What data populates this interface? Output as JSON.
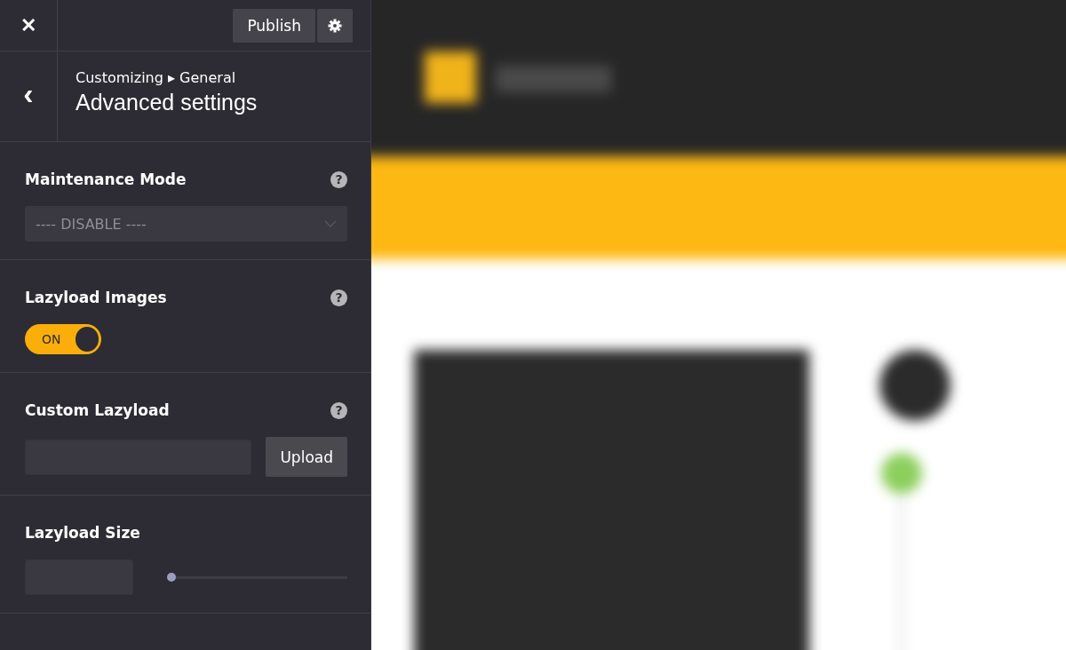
{
  "header": {
    "close": "✕",
    "publish": "Publish"
  },
  "breadcrumb": {
    "back": "‹",
    "path": "Customizing ▸ General",
    "title": "Advanced settings"
  },
  "settings": [
    {
      "kind": "select",
      "label": "Maintenance Mode",
      "help": "?",
      "value": "---- DISABLE ----"
    },
    {
      "kind": "toggle",
      "label": "Lazyload Images",
      "help": "?",
      "on": true,
      "state_label": "ON"
    },
    {
      "kind": "upload",
      "label": "Custom Lazyload",
      "help": "?",
      "button": "Upload"
    },
    {
      "kind": "slider",
      "label": "Lazyload Size",
      "level": 0
    }
  ]
}
